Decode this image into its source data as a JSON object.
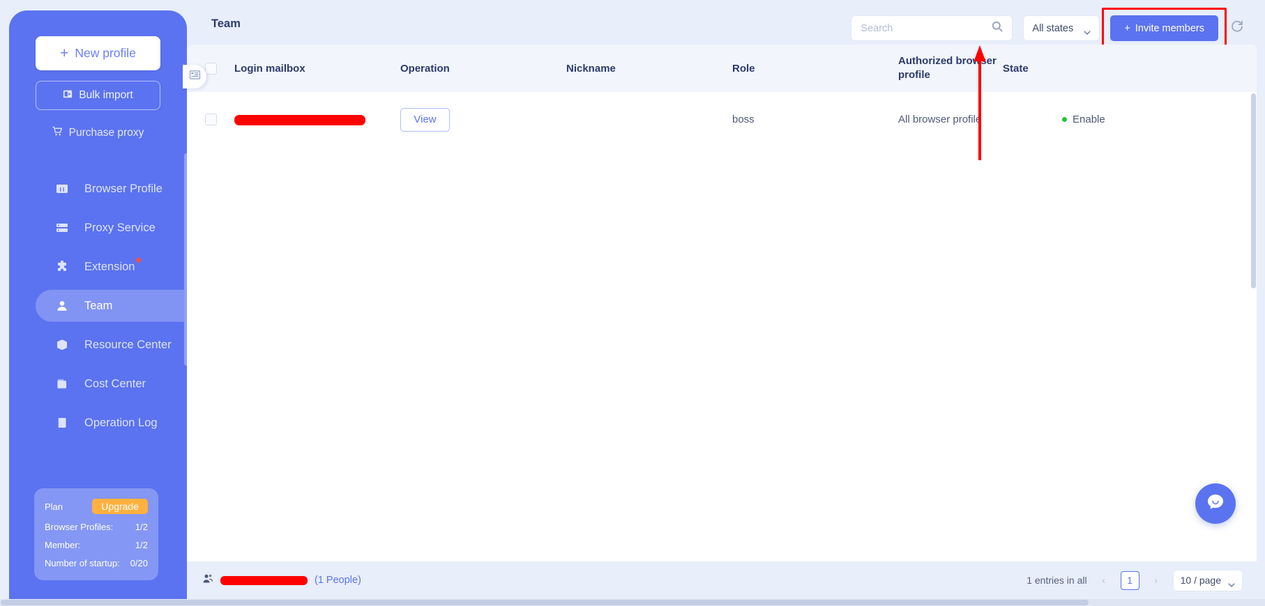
{
  "sidebar": {
    "new_profile": {
      "label": "New profile",
      "icon": "plus-icon"
    },
    "bulk_import": {
      "label": "Bulk import",
      "icon": "import-icon"
    },
    "purchase_proxy": {
      "label": "Purchase proxy",
      "icon": "cart-icon"
    },
    "nav_items": [
      {
        "label": "Browser Profile",
        "icon": "browser-icon",
        "active": false,
        "badge": false
      },
      {
        "label": "Proxy Service",
        "icon": "server-icon",
        "active": false,
        "badge": false
      },
      {
        "label": "Extension",
        "icon": "puzzle-icon",
        "active": false,
        "badge": true
      },
      {
        "label": "Team",
        "icon": "user-icon",
        "active": true,
        "badge": false
      },
      {
        "label": "Resource Center",
        "icon": "box-icon",
        "active": false,
        "badge": false
      },
      {
        "label": "Cost Center",
        "icon": "wallet-icon",
        "active": false,
        "badge": false
      },
      {
        "label": "Operation Log",
        "icon": "log-icon",
        "active": false,
        "badge": false
      }
    ],
    "plan": {
      "title": "Plan",
      "upgrade_label": "Upgrade",
      "rows": [
        {
          "label": "Browser Profiles:",
          "value": "1/2"
        },
        {
          "label": "Member:",
          "value": "1/2"
        },
        {
          "label": "Number of startup:",
          "value": "0/20"
        }
      ]
    }
  },
  "header": {
    "title": "Team",
    "search": {
      "placeholder": "Search",
      "value": "",
      "icon": "search-icon"
    },
    "state_filter": {
      "selected": "All states",
      "icon": "chevron-down-icon"
    },
    "invite_button": {
      "label": "Invite members",
      "icon": "plus-icon"
    },
    "refresh": {
      "icon": "refresh-icon"
    },
    "collapse_toggle": {
      "icon": "collapse-panel-icon"
    }
  },
  "table": {
    "columns": [
      "Login mailbox",
      "Operation",
      "Nickname",
      "Role",
      "Authorized browser profile",
      "State"
    ],
    "rows": [
      {
        "login_mailbox": "",
        "login_mailbox_redacted": true,
        "operation_label": "View",
        "nickname": "",
        "role": "boss",
        "authorized_browser_profile": "All browser profile",
        "state": "Enable",
        "state_color": "#20c832"
      }
    ]
  },
  "footer": {
    "team_name_redacted": true,
    "people_count": "(1 People)",
    "entries_text": "1 entries in all",
    "current_page": "1",
    "page_size": "10 / page",
    "prev_icon": "chevron-left-icon",
    "next_icon": "chevron-right-icon"
  },
  "chat": {
    "icon": "chat-bubble-icon"
  },
  "colors": {
    "brand": "#5b73f0",
    "accent_orange": "#ffb13f",
    "status_green": "#20c832",
    "annotation_red": "#ff0000",
    "page_bg": "#e8eefa"
  }
}
